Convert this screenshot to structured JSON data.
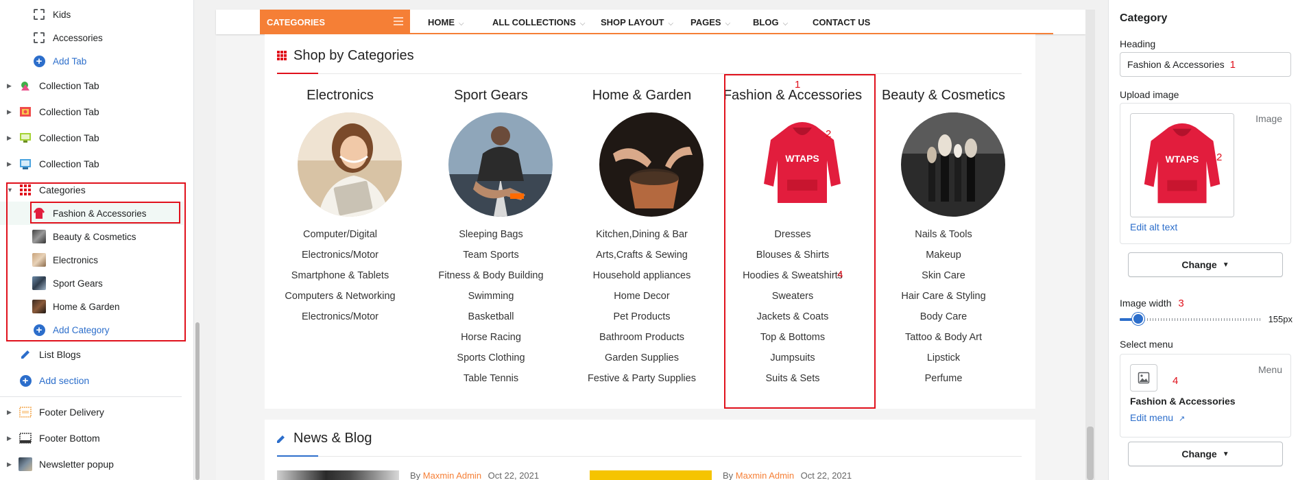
{
  "sidebar": {
    "items": [
      {
        "label": "Kids",
        "type": "sub"
      },
      {
        "label": "Accessories",
        "type": "sub"
      },
      {
        "label": "Add Tab",
        "type": "add"
      },
      {
        "label": "Collection Tab",
        "type": "section"
      },
      {
        "label": "Collection Tab",
        "type": "section"
      },
      {
        "label": "Collection Tab",
        "type": "section"
      },
      {
        "label": "Collection Tab",
        "type": "section"
      },
      {
        "label": "Categories",
        "type": "section-open"
      },
      {
        "label": "Fashion & Accessories",
        "type": "sub"
      },
      {
        "label": "Beauty & Cosmetics",
        "type": "sub"
      },
      {
        "label": "Electronics",
        "type": "sub"
      },
      {
        "label": "Sport Gears",
        "type": "sub"
      },
      {
        "label": "Home & Garden",
        "type": "sub"
      },
      {
        "label": "Add Category",
        "type": "add"
      },
      {
        "label": "List Blogs",
        "type": "section"
      },
      {
        "label": "Add section",
        "type": "add"
      },
      {
        "label": "Footer Delivery",
        "type": "section"
      },
      {
        "label": "Footer Bottom",
        "type": "section"
      },
      {
        "label": "Newsletter popup",
        "type": "section"
      }
    ]
  },
  "navbar": {
    "categories_label": "CATEGORIES",
    "items": [
      "HOME",
      "ALL COLLECTIONS",
      "SHOP LAYOUT",
      "PAGES",
      "BLOG",
      "CONTACT US"
    ]
  },
  "shop_section": {
    "title": "Shop by Categories",
    "columns": [
      {
        "heading": "Electronics",
        "links": [
          "Computer/Digital",
          "Electronics/Motor",
          "Smartphone & Tablets",
          "Computers & Networking",
          "Electronics/Motor"
        ]
      },
      {
        "heading": "Sport Gears",
        "links": [
          "Sleeping Bags",
          "Team Sports",
          "Fitness & Body Building",
          "Swimming",
          "Basketball",
          "Horse Racing",
          "Sports Clothing",
          "Table Tennis"
        ]
      },
      {
        "heading": "Home & Garden",
        "links": [
          "Kitchen,Dining & Bar",
          "Arts,Crafts & Sewing",
          "Household appliances",
          "Home Decor",
          "Pet Products",
          "Bathroom Products",
          "Garden Supplies",
          "Festive & Party Supplies"
        ]
      },
      {
        "heading": "Fashion & Accessories",
        "links": [
          "Dresses",
          "Blouses & Shirts",
          "Hoodies & Sweatshirts",
          "Sweaters",
          "Jackets & Coats",
          "Top & Bottoms",
          "Jumpsuits",
          "Suits & Sets"
        ]
      },
      {
        "heading": "Beauty & Cosmetics",
        "links": [
          "Nails & Tools",
          "Makeup",
          "Skin Care",
          "Hair Care & Styling",
          "Body Care",
          "Tattoo & Body Art",
          "Lipstick",
          "Perfume"
        ]
      }
    ],
    "hoodie_text": "WTAPS"
  },
  "blog_section": {
    "title": "News & Blog",
    "posts": [
      {
        "by": "By",
        "author": "Maxmin Admin",
        "date": "Oct 22, 2021"
      },
      {
        "by": "By",
        "author": "Maxmin Admin",
        "date": "Oct 22, 2021"
      }
    ]
  },
  "annotations": {
    "n1": "1",
    "n2": "2",
    "n3": "3",
    "n4": "4"
  },
  "panel": {
    "title": "Category",
    "heading_label": "Heading",
    "heading_value": "Fashion & Accessories",
    "upload_label": "Upload image",
    "image_side_label": "Image",
    "edit_alt_text": "Edit alt text",
    "change_label": "Change",
    "width_label": "Image width",
    "width_value": "155px",
    "width_slider_fraction": 0.13,
    "select_menu_label": "Select menu",
    "menu_side_label": "Menu",
    "menu_name": "Fashion & Accessories",
    "edit_menu": "Edit menu"
  },
  "colors": {
    "accent_orange": "#f57f36",
    "annotation_red": "#e0101b",
    "link_blue": "#2c6ecb"
  }
}
